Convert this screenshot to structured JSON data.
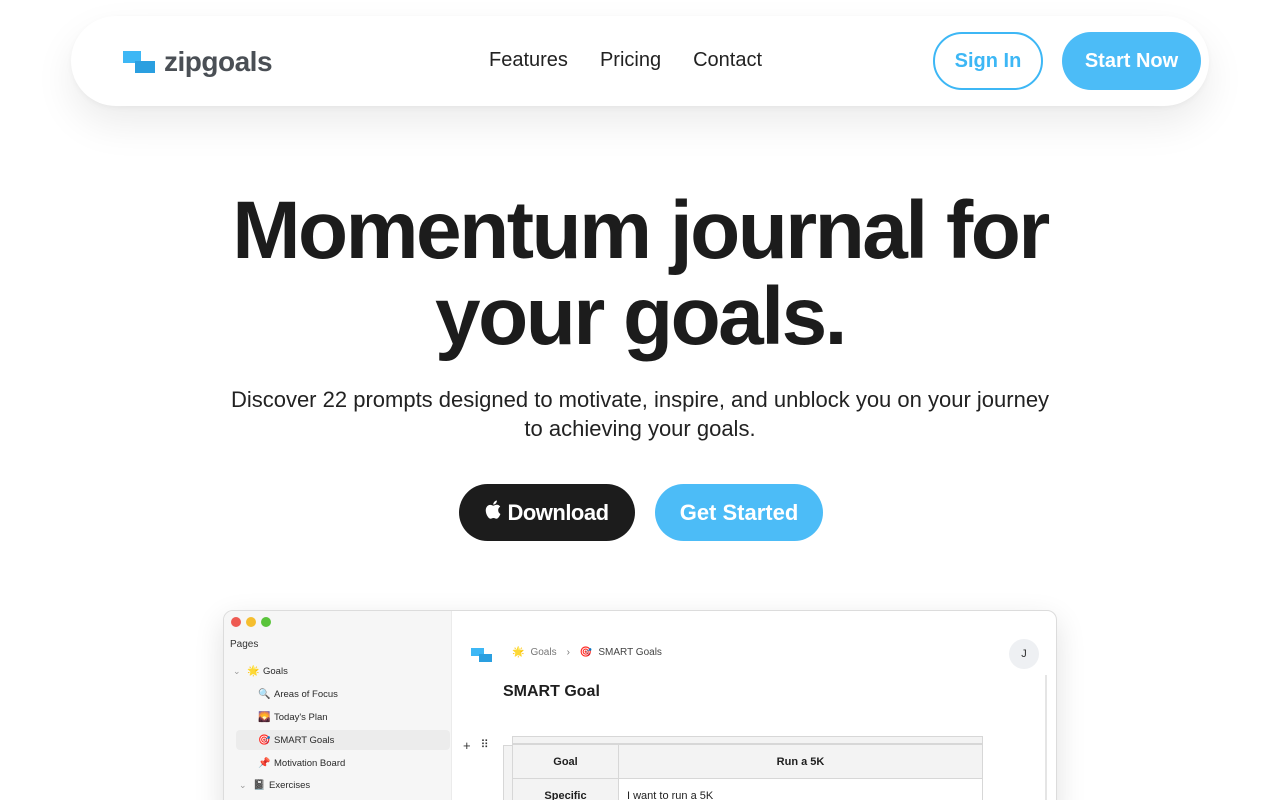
{
  "nav": {
    "brand": "zipgoals",
    "links": [
      "Features",
      "Pricing",
      "Contact"
    ],
    "sign_in": "Sign In",
    "start_now": "Start Now",
    "accent_color": "#4cbcf7"
  },
  "hero": {
    "title_line1": "Momentum journal for",
    "title_line2": "your goals.",
    "subtitle": "Discover 22 prompts designed to motivate, inspire, and unblock you on your journey to achieving your goals.",
    "download_label": "Download",
    "download_icon": "apple-icon",
    "get_started_label": "Get Started"
  },
  "app": {
    "sidebar": {
      "title": "Pages",
      "items": [
        {
          "label": "Goals",
          "icon": "🌟",
          "chevron": "⌄"
        },
        {
          "label": "Areas of Focus",
          "icon": "🔍"
        },
        {
          "label": "Today's Plan",
          "icon": "🌄"
        },
        {
          "label": "SMART Goals",
          "icon": "🎯"
        },
        {
          "label": "Motivation Board",
          "icon": "📌"
        },
        {
          "label": "Exercises",
          "icon": "📓",
          "chevron": "⌄"
        }
      ]
    },
    "breadcrumb": {
      "parent": "Goals",
      "parent_icon": "🌟",
      "separator": "›",
      "current": "SMART Goals",
      "current_icon": "🎯"
    },
    "avatar": "J",
    "page_title": "SMART Goal",
    "block_add": "+",
    "block_drag": "⠿",
    "table": {
      "header": [
        "Goal",
        "Run a 5K"
      ],
      "rows": [
        [
          "Specific",
          "I want to run a 5K"
        ]
      ]
    }
  }
}
